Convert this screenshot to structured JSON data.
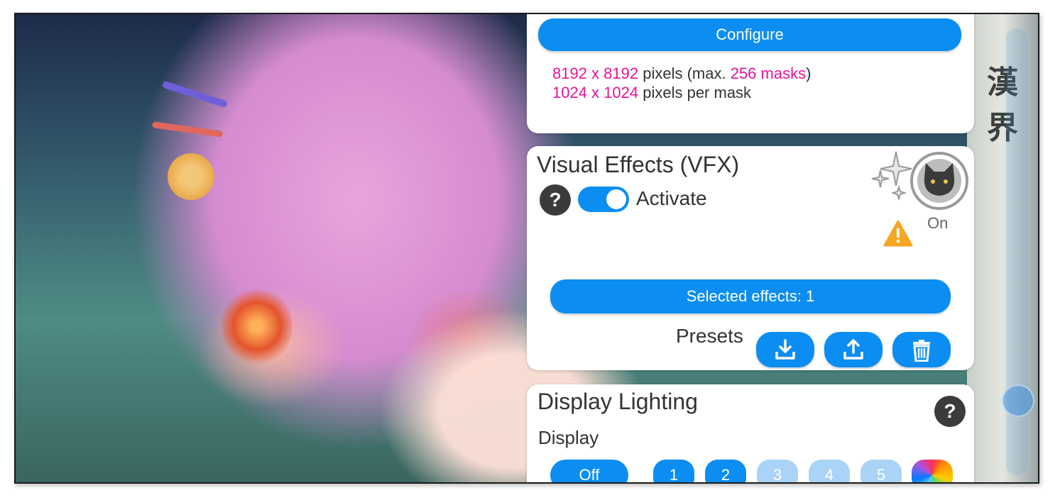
{
  "mask_panel": {
    "configure_label": "Configure",
    "line1": {
      "dims": "8192 x 8192",
      "mid": " pixels (max. ",
      "max": "256 masks",
      "end": ")"
    },
    "line2": {
      "dims": "1024 x 1024",
      "end": " pixels per mask"
    }
  },
  "vfx_panel": {
    "title": "Visual Effects (VFX)",
    "help_label": "?",
    "activate_label": "Activate",
    "activate_on": true,
    "status_label": "On",
    "selected_effects_label": "Selected effects: 1",
    "presets_label": "Presets",
    "icons": [
      "download-icon",
      "upload-icon",
      "trash-icon",
      "sparkle-icon",
      "cat-icon",
      "warning-icon"
    ]
  },
  "display_lighting_panel": {
    "title": "Display Lighting",
    "help_label": "?",
    "display_label": "Display",
    "off_label": "Off",
    "channels": [
      {
        "label": "1",
        "active": true
      },
      {
        "label": "2",
        "active": true
      },
      {
        "label": "3",
        "active": false
      },
      {
        "label": "4",
        "active": false
      },
      {
        "label": "5",
        "active": false
      }
    ],
    "color_wheel_icon": "color-wheel-icon"
  },
  "background_sign_text": "漢 界",
  "colors": {
    "accent": "#0b8df2",
    "highlight": "#e6139a",
    "warning": "#f5a623",
    "inactive": "#a9d4f7"
  }
}
